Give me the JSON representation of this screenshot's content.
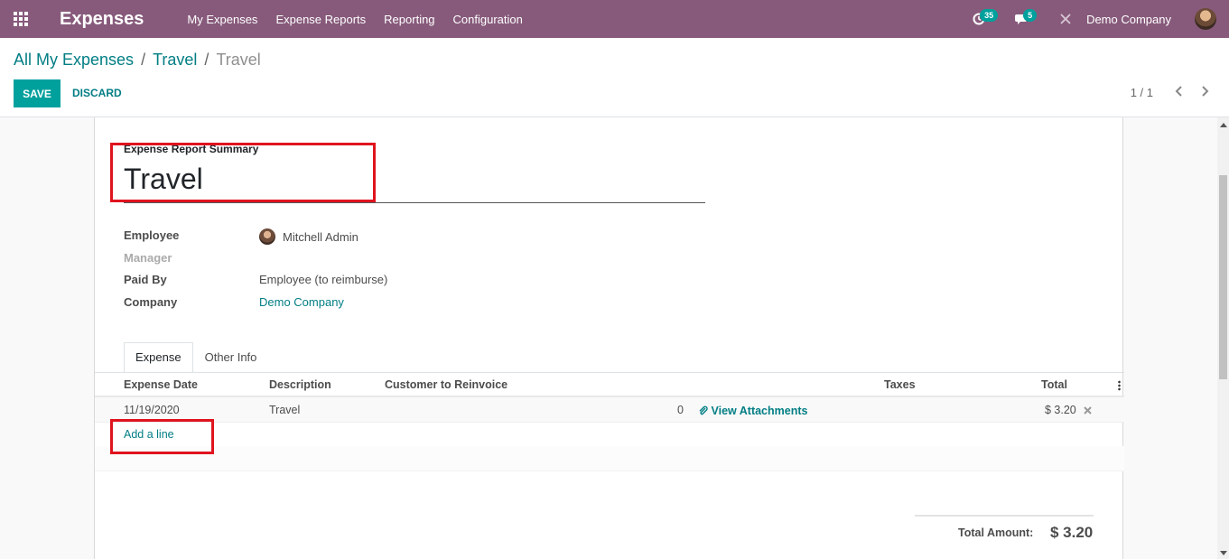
{
  "navbar": {
    "app_title": "Expenses",
    "menu": [
      "My Expenses",
      "Expense Reports",
      "Reporting",
      "Configuration"
    ],
    "activity_count": "35",
    "messages_count": "5",
    "company": "Demo Company",
    "color": "#875a7b"
  },
  "breadcrumb": {
    "items": [
      "All My Expenses",
      "Travel"
    ],
    "separator": "/",
    "current": "Travel"
  },
  "toolbar": {
    "save_label": "SAVE",
    "discard_label": "DISCARD",
    "pager": "1 / 1"
  },
  "form": {
    "summary_label": "Expense Report Summary",
    "summary_value": "Travel",
    "fields": {
      "employee_label": "Employee",
      "employee_value": "Mitchell Admin",
      "manager_label": "Manager",
      "manager_value": "",
      "paid_by_label": "Paid By",
      "paid_by_value": "Employee (to reimburse)",
      "company_label": "Company",
      "company_value": "Demo Company"
    },
    "tabs": [
      "Expense",
      "Other Info"
    ],
    "active_tab": "Expense"
  },
  "expense_lines": {
    "columns": [
      "Expense Date",
      "Description",
      "Customer to Reinvoice",
      "Taxes",
      "Total"
    ],
    "rows": [
      {
        "date": "11/19/2020",
        "description": "Travel",
        "customer": "",
        "quantity": "0",
        "attachments_label": "View Attachments",
        "taxes": "",
        "total": "$ 3.20"
      }
    ],
    "add_line_label": "Add a line"
  },
  "totals": {
    "label": "Total Amount:",
    "value": "$ 3.20"
  },
  "colors": {
    "accent": "#00a09d",
    "link": "#017e84",
    "highlight": "#e0141e"
  }
}
